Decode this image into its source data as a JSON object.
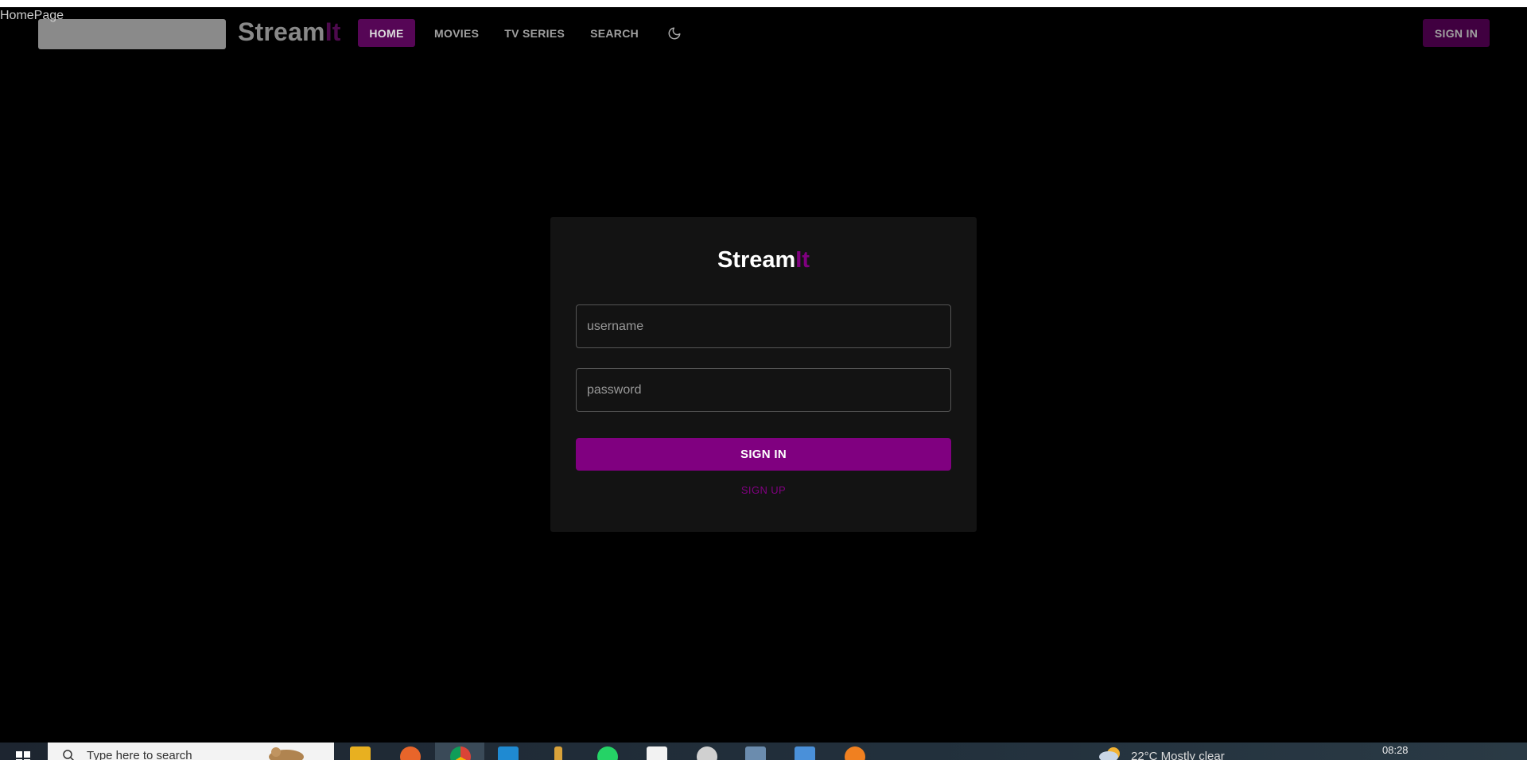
{
  "page": {
    "tab_label": "HomePage"
  },
  "header": {
    "brand_main": "Stream",
    "brand_accent": "It",
    "nav": [
      {
        "label": "HOME",
        "active": true
      },
      {
        "label": "MOVIES",
        "active": false
      },
      {
        "label": "TV SERIES",
        "active": false
      },
      {
        "label": "SEARCH",
        "active": false
      }
    ],
    "theme_icon": "moon-icon",
    "signin_label": "SIGN IN"
  },
  "login": {
    "brand_main": "Stream",
    "brand_accent": "It",
    "username_placeholder": "username",
    "password_placeholder": "password",
    "submit_label": "SIGN IN",
    "signup_label": "SIGN UP"
  },
  "taskbar": {
    "search_placeholder": "Type here to search",
    "weather": "22°C  Mostly clear",
    "time": "08:28",
    "icons": [
      "windows-start-icon",
      "file-explorer-icon",
      "firefox-icon",
      "chrome-icon",
      "vscode-icon",
      "paint-icon",
      "whatsapp-icon",
      "pdf-icon",
      "settings-icon",
      "app-icon",
      "mail-icon",
      "app-icon"
    ]
  },
  "colors": {
    "accent": "#800080",
    "accent_dark": "#560656",
    "background": "#000000",
    "card": "#131313"
  }
}
